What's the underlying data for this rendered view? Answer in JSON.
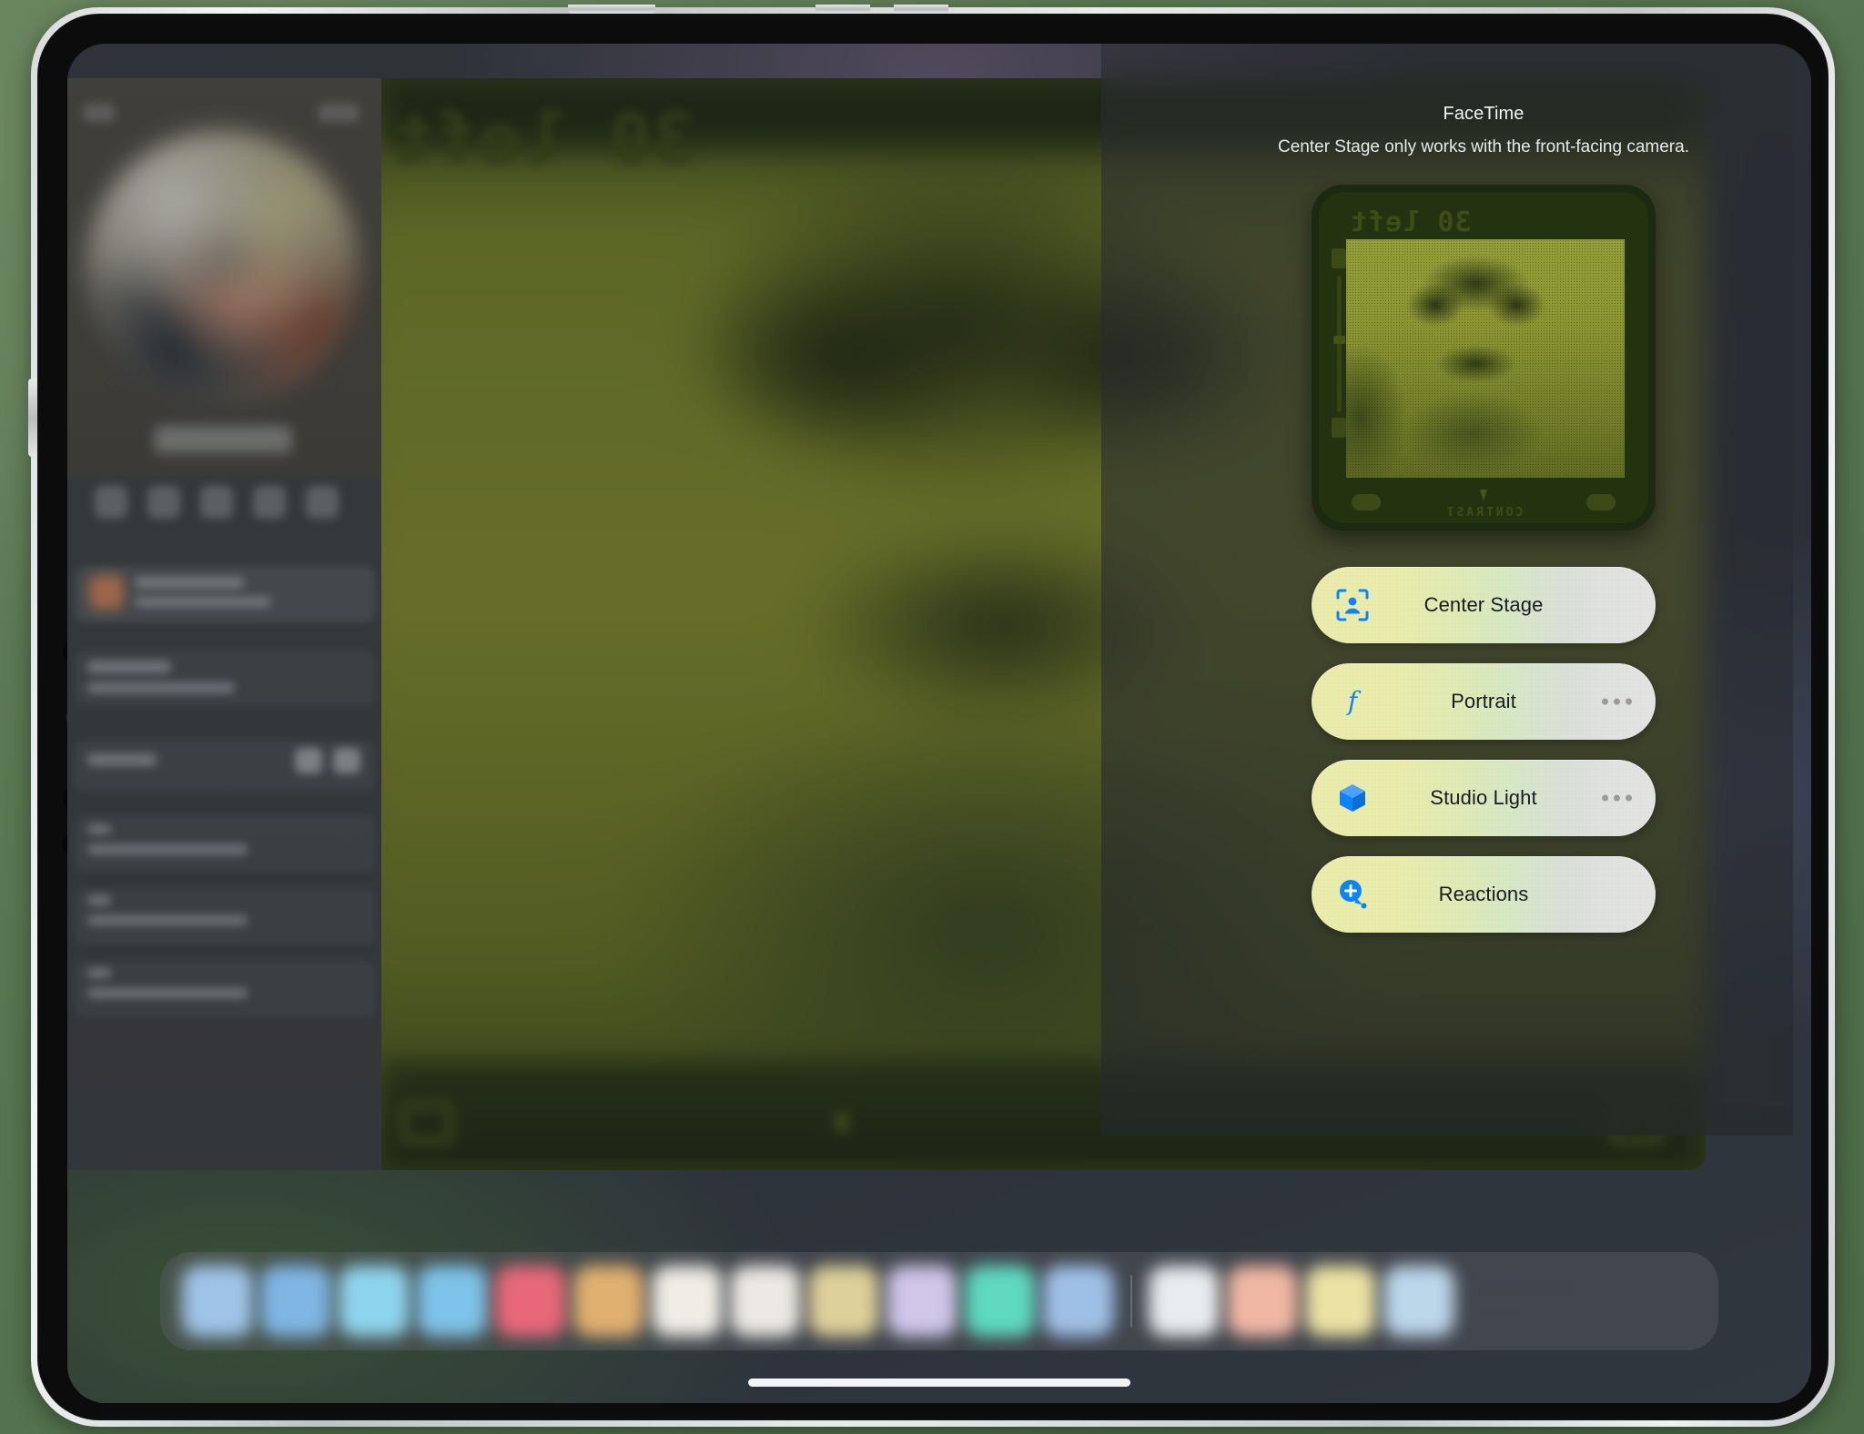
{
  "panel": {
    "title": "FaceTime",
    "subtitle": "Center Stage only works with the front-facing camera.",
    "accent_blue": "#0a84ff",
    "pill_start_color": "#eaecab",
    "pill_end_color": "#e3e4e2",
    "effects": [
      {
        "label": "Center Stage",
        "icon": "center-stage-icon",
        "has_more": false
      },
      {
        "label": "Portrait",
        "icon": "portrait-aperture-icon",
        "has_more": true
      },
      {
        "label": "Studio Light",
        "icon": "studio-light-cube-icon",
        "has_more": true
      },
      {
        "label": "Reactions",
        "icon": "reactions-bubble-plus-icon",
        "has_more": false
      }
    ]
  },
  "preview": {
    "name": "self-view-preview",
    "counter_text": "30 left",
    "contrast_label": "CONTRAST"
  },
  "video_feed": {
    "overlay_text": "30 left"
  },
  "dock": {
    "icon_colors": [
      "#9fc4e8",
      "#7fb6e4",
      "#8fd4ee",
      "#7ec3e9",
      "#e8687a",
      "#e0b070",
      "#f0ece6",
      "#ece9e4",
      "#ded09a",
      "#cfc6e8",
      "#5fd9c0",
      "#9fc0e6"
    ],
    "recent_colors": [
      "#e9ecee",
      "#f0b8a4",
      "#ece2a4",
      "#bcd6ea"
    ]
  },
  "device": {
    "name": "ipad-frame",
    "bezel_color": "#0c0c0d",
    "frame_color": "#d8dadb"
  }
}
